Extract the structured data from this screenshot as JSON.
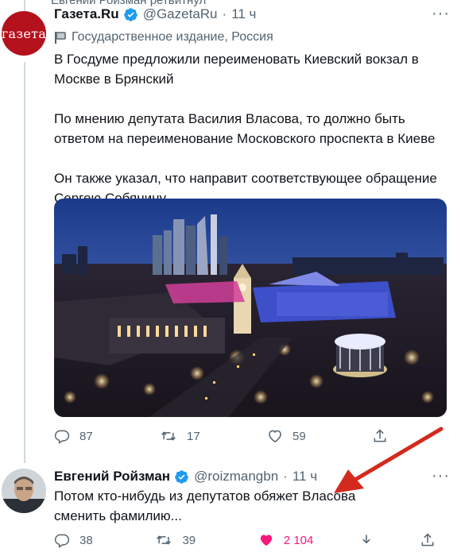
{
  "top_tweet": {
    "name": "Газета.Ru",
    "handle": "@GazetaRu",
    "time": "11 ч",
    "avatar_text": "газета",
    "label": "Государственное издание, Россия",
    "paragraphs": [
      "В Госдуме предложили переименовать Киевский вокзал в Москве в Брянский",
      "По мнению депутата Василия Власова, то должно быть ответом на переименование Московского проспекта в Киеве",
      "Он также указал, что направит соответствующее обращение Сергею Собянину"
    ],
    "actions": {
      "replies": "87",
      "retweets": "17",
      "likes": "59"
    }
  },
  "reply_tweet": {
    "name": "Евгений Ройзман",
    "handle": "@roizmangbn",
    "time": "11 ч",
    "text": "Потом кто-нибудь из депутатов обяжет Власова сменить фамилию...",
    "actions": {
      "replies": "38",
      "retweets": "39",
      "likes": "2 104"
    }
  },
  "colors": {
    "verified": "#1d9bf0",
    "like_active": "#f91880",
    "arrow": "#d42a1e",
    "avatar_brand": "#b3111c"
  },
  "icons": [
    "verified-badge-icon",
    "flag-icon",
    "reply-icon",
    "retweet-icon",
    "like-icon",
    "share-icon",
    "more-icon"
  ]
}
